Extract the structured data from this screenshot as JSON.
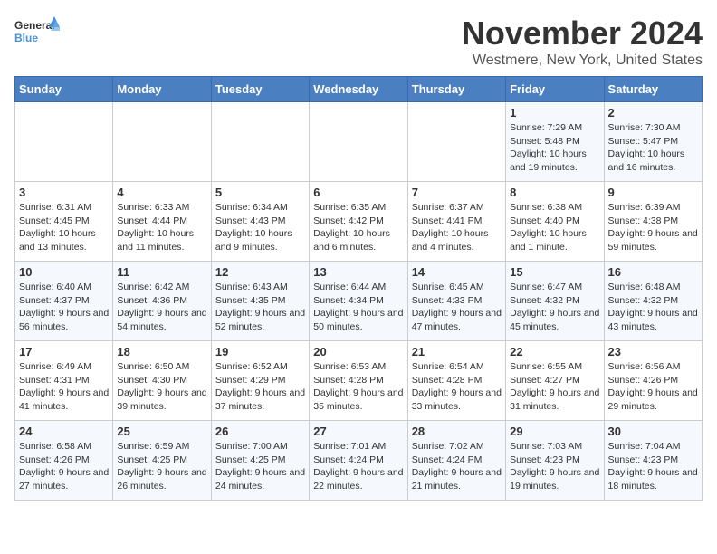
{
  "logo": {
    "general": "General",
    "blue": "Blue"
  },
  "title": "November 2024",
  "location": "Westmere, New York, United States",
  "weekdays": [
    "Sunday",
    "Monday",
    "Tuesday",
    "Wednesday",
    "Thursday",
    "Friday",
    "Saturday"
  ],
  "weeks": [
    [
      {
        "day": "",
        "info": ""
      },
      {
        "day": "",
        "info": ""
      },
      {
        "day": "",
        "info": ""
      },
      {
        "day": "",
        "info": ""
      },
      {
        "day": "",
        "info": ""
      },
      {
        "day": "1",
        "info": "Sunrise: 7:29 AM\nSunset: 5:48 PM\nDaylight: 10 hours and 19 minutes."
      },
      {
        "day": "2",
        "info": "Sunrise: 7:30 AM\nSunset: 5:47 PM\nDaylight: 10 hours and 16 minutes."
      }
    ],
    [
      {
        "day": "3",
        "info": "Sunrise: 6:31 AM\nSunset: 4:45 PM\nDaylight: 10 hours and 13 minutes."
      },
      {
        "day": "4",
        "info": "Sunrise: 6:33 AM\nSunset: 4:44 PM\nDaylight: 10 hours and 11 minutes."
      },
      {
        "day": "5",
        "info": "Sunrise: 6:34 AM\nSunset: 4:43 PM\nDaylight: 10 hours and 9 minutes."
      },
      {
        "day": "6",
        "info": "Sunrise: 6:35 AM\nSunset: 4:42 PM\nDaylight: 10 hours and 6 minutes."
      },
      {
        "day": "7",
        "info": "Sunrise: 6:37 AM\nSunset: 4:41 PM\nDaylight: 10 hours and 4 minutes."
      },
      {
        "day": "8",
        "info": "Sunrise: 6:38 AM\nSunset: 4:40 PM\nDaylight: 10 hours and 1 minute."
      },
      {
        "day": "9",
        "info": "Sunrise: 6:39 AM\nSunset: 4:38 PM\nDaylight: 9 hours and 59 minutes."
      }
    ],
    [
      {
        "day": "10",
        "info": "Sunrise: 6:40 AM\nSunset: 4:37 PM\nDaylight: 9 hours and 56 minutes."
      },
      {
        "day": "11",
        "info": "Sunrise: 6:42 AM\nSunset: 4:36 PM\nDaylight: 9 hours and 54 minutes."
      },
      {
        "day": "12",
        "info": "Sunrise: 6:43 AM\nSunset: 4:35 PM\nDaylight: 9 hours and 52 minutes."
      },
      {
        "day": "13",
        "info": "Sunrise: 6:44 AM\nSunset: 4:34 PM\nDaylight: 9 hours and 50 minutes."
      },
      {
        "day": "14",
        "info": "Sunrise: 6:45 AM\nSunset: 4:33 PM\nDaylight: 9 hours and 47 minutes."
      },
      {
        "day": "15",
        "info": "Sunrise: 6:47 AM\nSunset: 4:32 PM\nDaylight: 9 hours and 45 minutes."
      },
      {
        "day": "16",
        "info": "Sunrise: 6:48 AM\nSunset: 4:32 PM\nDaylight: 9 hours and 43 minutes."
      }
    ],
    [
      {
        "day": "17",
        "info": "Sunrise: 6:49 AM\nSunset: 4:31 PM\nDaylight: 9 hours and 41 minutes."
      },
      {
        "day": "18",
        "info": "Sunrise: 6:50 AM\nSunset: 4:30 PM\nDaylight: 9 hours and 39 minutes."
      },
      {
        "day": "19",
        "info": "Sunrise: 6:52 AM\nSunset: 4:29 PM\nDaylight: 9 hours and 37 minutes."
      },
      {
        "day": "20",
        "info": "Sunrise: 6:53 AM\nSunset: 4:28 PM\nDaylight: 9 hours and 35 minutes."
      },
      {
        "day": "21",
        "info": "Sunrise: 6:54 AM\nSunset: 4:28 PM\nDaylight: 9 hours and 33 minutes."
      },
      {
        "day": "22",
        "info": "Sunrise: 6:55 AM\nSunset: 4:27 PM\nDaylight: 9 hours and 31 minutes."
      },
      {
        "day": "23",
        "info": "Sunrise: 6:56 AM\nSunset: 4:26 PM\nDaylight: 9 hours and 29 minutes."
      }
    ],
    [
      {
        "day": "24",
        "info": "Sunrise: 6:58 AM\nSunset: 4:26 PM\nDaylight: 9 hours and 27 minutes."
      },
      {
        "day": "25",
        "info": "Sunrise: 6:59 AM\nSunset: 4:25 PM\nDaylight: 9 hours and 26 minutes."
      },
      {
        "day": "26",
        "info": "Sunrise: 7:00 AM\nSunset: 4:25 PM\nDaylight: 9 hours and 24 minutes."
      },
      {
        "day": "27",
        "info": "Sunrise: 7:01 AM\nSunset: 4:24 PM\nDaylight: 9 hours and 22 minutes."
      },
      {
        "day": "28",
        "info": "Sunrise: 7:02 AM\nSunset: 4:24 PM\nDaylight: 9 hours and 21 minutes."
      },
      {
        "day": "29",
        "info": "Sunrise: 7:03 AM\nSunset: 4:23 PM\nDaylight: 9 hours and 19 minutes."
      },
      {
        "day": "30",
        "info": "Sunrise: 7:04 AM\nSunset: 4:23 PM\nDaylight: 9 hours and 18 minutes."
      }
    ]
  ]
}
